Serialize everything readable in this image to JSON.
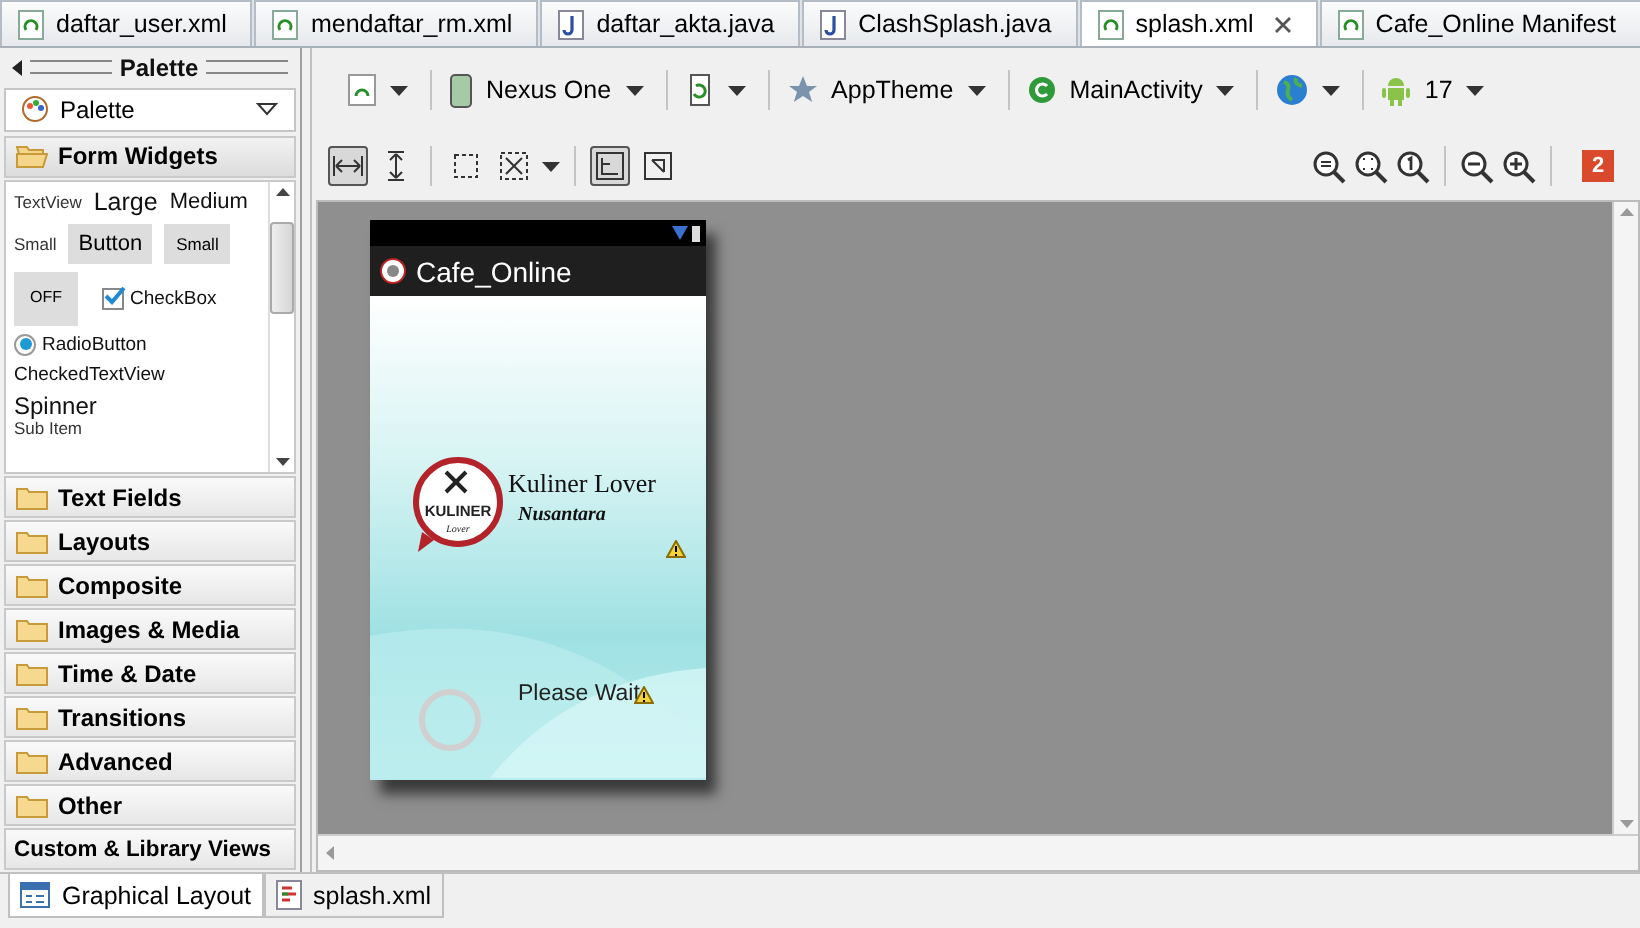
{
  "editor_tabs": [
    {
      "label": "daftar_user.xml",
      "kind": "xml",
      "selected": false
    },
    {
      "label": "mendaftar_rm.xml",
      "kind": "xml",
      "selected": false
    },
    {
      "label": "daftar_akta.java",
      "kind": "java",
      "selected": false
    },
    {
      "label": "ClashSplash.java",
      "kind": "java",
      "selected": false
    },
    {
      "label": "splash.xml",
      "kind": "xml",
      "selected": true
    },
    {
      "label": "Cafe_Online Manifest",
      "kind": "xml",
      "selected": false
    }
  ],
  "palette": {
    "title": "Palette",
    "selector": "Palette",
    "categories": [
      {
        "label": "Form Widgets",
        "kind": "folder",
        "expanded": true
      },
      {
        "label": "Text Fields",
        "kind": "folder",
        "expanded": false
      },
      {
        "label": "Layouts",
        "kind": "folder",
        "expanded": false
      },
      {
        "label": "Composite",
        "kind": "folder",
        "expanded": false
      },
      {
        "label": "Images & Media",
        "kind": "folder",
        "expanded": false
      },
      {
        "label": "Time & Date",
        "kind": "folder",
        "expanded": false
      },
      {
        "label": "Transitions",
        "kind": "folder",
        "expanded": false
      },
      {
        "label": "Advanced",
        "kind": "folder",
        "expanded": false
      },
      {
        "label": "Other",
        "kind": "folder",
        "expanded": false
      },
      {
        "label": "Custom & Library Views",
        "kind": "plain",
        "expanded": false
      }
    ],
    "form_widgets": {
      "textview": "TextView",
      "large": "Large",
      "medium": "Medium",
      "small_label": "Small",
      "button": "Button",
      "small_button": "Small",
      "toggle": "OFF",
      "checkbox": {
        "label": "CheckBox",
        "checked": true
      },
      "radio": {
        "label": "RadioButton",
        "selected": true
      },
      "checked_textview": "CheckedTextView",
      "spinner": "Spinner",
      "spinner_sub": "Sub Item"
    }
  },
  "config_toolbar": [
    {
      "kind": "layout"
    },
    {
      "kind": "device",
      "label": "Nexus One"
    },
    {
      "kind": "orientation"
    },
    {
      "kind": "theme",
      "label": "AppTheme"
    },
    {
      "kind": "activity",
      "label": "MainActivity"
    },
    {
      "kind": "locale"
    },
    {
      "kind": "api",
      "label": "17"
    }
  ],
  "view_toolbar": [
    {
      "kind": "fit-width",
      "selected": true
    },
    {
      "kind": "fit-height",
      "selected": false
    },
    {
      "kind": "clip",
      "selected": false
    },
    {
      "kind": "expand",
      "selected": false
    },
    {
      "kind": "layout-left",
      "selected": true
    },
    {
      "kind": "layout-swap",
      "selected": false
    }
  ],
  "error_count": "2",
  "device": {
    "app_title": "Cafe_Online",
    "logo_text": "KULINER",
    "logo_subtext": "Lover",
    "brand": "Kuliner Lover",
    "brand_sub": "Nusantara",
    "loading_text": "Please Wait"
  },
  "bottom_tabs": [
    {
      "label": "Graphical Layout",
      "kind": "design",
      "selected": true
    },
    {
      "label": "splash.xml",
      "kind": "source",
      "selected": false
    }
  ]
}
